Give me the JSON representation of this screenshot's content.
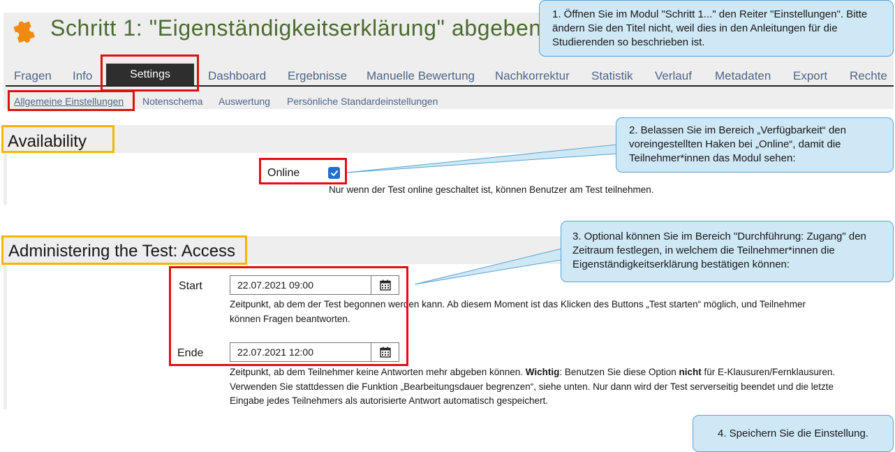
{
  "header": {
    "title": "Schritt 1: \"Eigenständigkeitserklärung\" abgeben",
    "icon": "puzzle-icon",
    "icon_color": "#f08a10",
    "title_color": "#4a6b2e"
  },
  "tabs": [
    {
      "label": "Fragen"
    },
    {
      "label": "Info"
    },
    {
      "label": "Settings",
      "active": true
    },
    {
      "label": "Dashboard"
    },
    {
      "label": "Ergebnisse"
    },
    {
      "label": "Manuelle Bewertung"
    },
    {
      "label": "Nachkorrektur"
    },
    {
      "label": "Statistik"
    },
    {
      "label": "Verlauf"
    },
    {
      "label": "Metadaten"
    },
    {
      "label": "Export"
    },
    {
      "label": "Rechte"
    }
  ],
  "subtabs": [
    {
      "label": "Allgemeine Einstellungen",
      "active": true
    },
    {
      "label": "Notenschema"
    },
    {
      "label": "Auswertung"
    },
    {
      "label": "Persönliche Standardeinstellungen"
    }
  ],
  "availability": {
    "title": "Availability",
    "online_label": "Online",
    "online_checked": true,
    "online_help": "Nur wenn der Test online geschaltet ist, können Benutzer am Test teilnehmen."
  },
  "access": {
    "title": "Administering the Test: Access",
    "start_label": "Start",
    "start_value": "22.07.2021 09:00",
    "start_help": "Zeitpunkt, ab dem der Test begonnen werden kann. Ab diesem Moment ist das Klicken des Buttons „Test starten“ möglich, und Teilnehmer können Fragen beantworten.",
    "end_label": "Ende",
    "end_value": "22.07.2021 12:00",
    "end_help_1": "Zeitpunkt, ab dem Teilnehmer keine Antworten mehr abgeben können. ",
    "end_help_bold_1": "Wichtig",
    "end_help_2": ": Benutzen Sie diese Option ",
    "end_help_bold_2": "nicht",
    "end_help_3": " für E-Klausuren/Fernklausuren. Verwenden Sie stattdessen die Funktion „Bearbeitungsdauer begrenzen“, siehe unten. Nur dann wird der Test serverseitig beendet und die letzte Eingabe jedes Teilnehmers als autorisierte Antwort automatisch gespeichert."
  },
  "callouts": {
    "c1": "1. Öffnen Sie im Modul \"Schritt 1...\" den Reiter \"Einstellungen\". Bitte ändern Sie den Titel nicht, weil dies in den Anleitungen für die Studierenden so beschrieben ist.",
    "c2": "2.  Belassen Sie im Bereich „Verfügbarkeit“ den voreingestellten Haken bei „Online“, damit die Teilnehmer*innen das Modul sehen:",
    "c3": "3. Optional können Sie im Bereich \"Durchführung: Zugang\" den Zeitraum festlegen, in welchem die Teilnehmer*innen die Eigenständigkeitserklärung bestätigen können:",
    "c4": "4. Speichern Sie die Einstellung."
  },
  "colors": {
    "annotation_red": "#e01010",
    "annotation_yellow": "#f7b500",
    "callout_bg": "#cfe8f6",
    "link": "#4c6586",
    "checkbox": "#1f6fd1"
  }
}
